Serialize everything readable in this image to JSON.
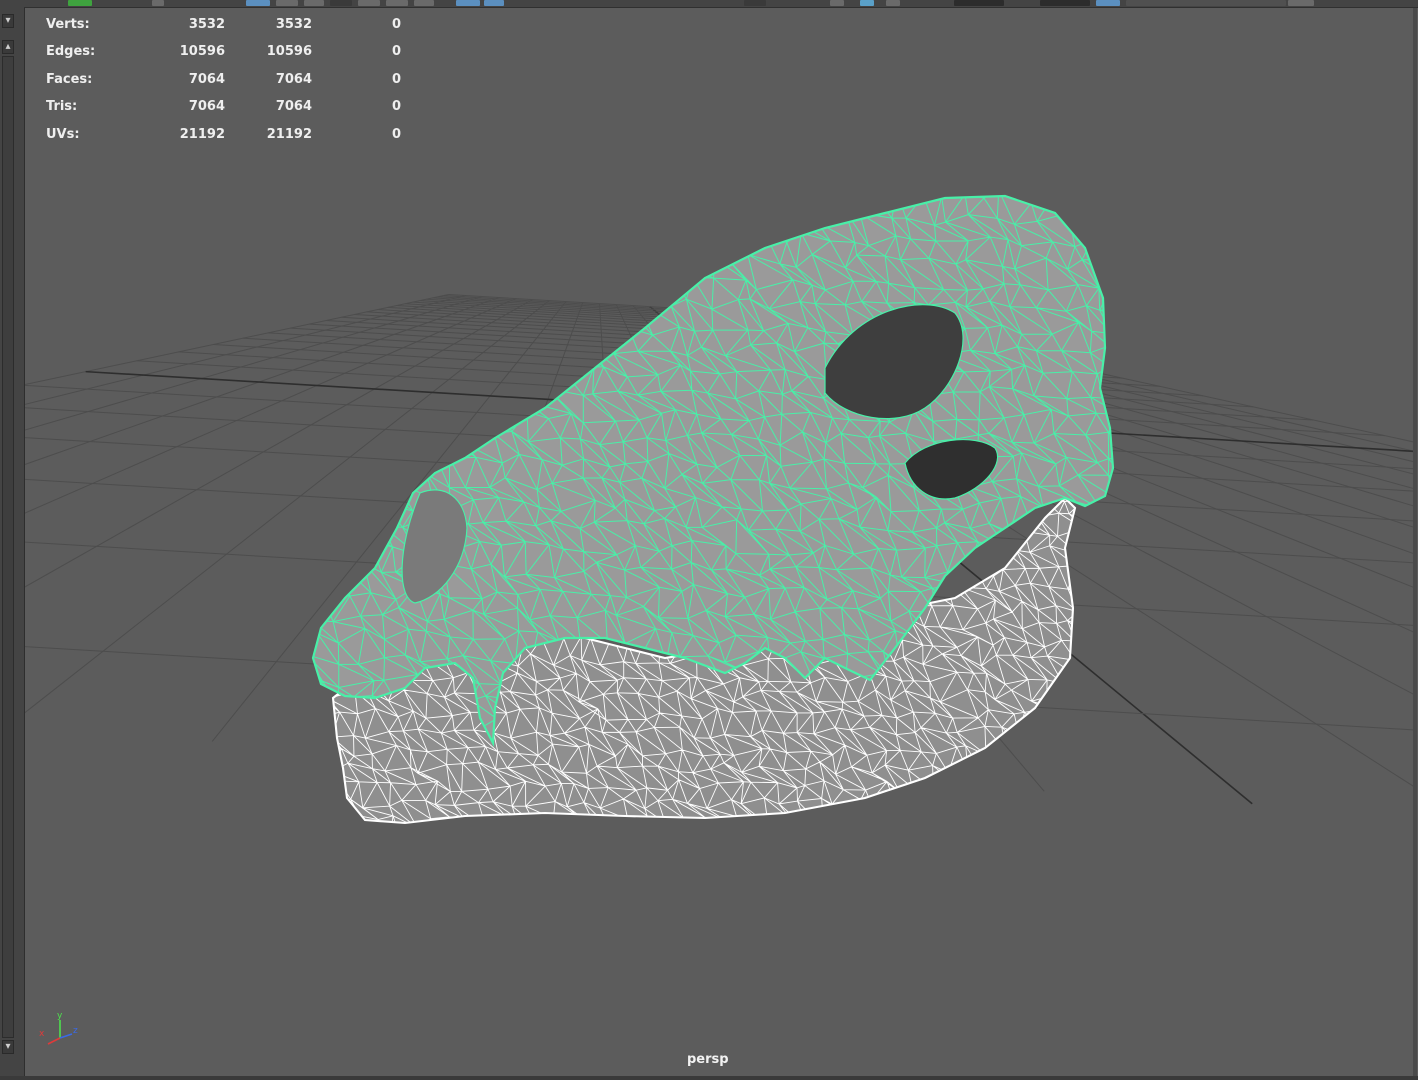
{
  "hud": {
    "rows": [
      {
        "label": "Verts:",
        "values": [
          "3532",
          "3532",
          "0"
        ]
      },
      {
        "label": "Edges:",
        "values": [
          "10596",
          "10596",
          "0"
        ]
      },
      {
        "label": "Faces:",
        "values": [
          "7064",
          "7064",
          "0"
        ]
      },
      {
        "label": "Tris:",
        "values": [
          "7064",
          "7064",
          "0"
        ]
      },
      {
        "label": "UVs:",
        "values": [
          "21192",
          "21192",
          "0"
        ]
      }
    ]
  },
  "viewport": {
    "camera": "persp",
    "axis": {
      "x": "x",
      "y": "y",
      "z": "z"
    }
  },
  "colors": {
    "background": "#5c5c5c",
    "grid": "#4d4d4d",
    "grid_major": "#2e2e2e",
    "selection_wire": "#48f0a8",
    "mesh_wire": "#ffffff",
    "axis_x": "#e03a3a",
    "axis_y": "#4ee04e",
    "axis_z": "#3a6ae8"
  },
  "icons": [
    "scroll-up-icon",
    "scroll-down-icon",
    "view-axis-icon"
  ]
}
